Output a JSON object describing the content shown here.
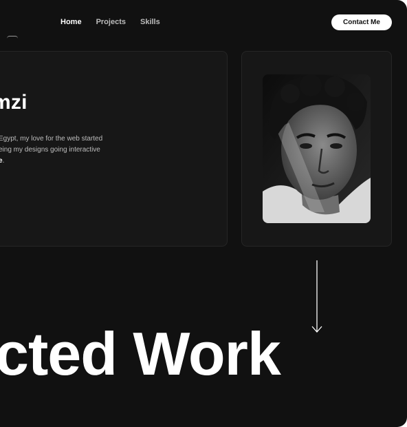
{
  "nav": {
    "items": [
      {
        "label": "Home",
        "active": true
      },
      {
        "label": "Projects",
        "active": false
      },
      {
        "label": "Skills",
        "active": false
      }
    ],
    "contact_label": "Contact Me"
  },
  "intro": {
    "title": "mzi",
    "lines": [
      "Egypt, my love for the web started",
      "eing my designs going interactive"
    ],
    "last_prefix": "",
    "last_emphasis": "e",
    "last_suffix": "."
  },
  "photo": {
    "icon": "profile-photo"
  },
  "scroll": {
    "icon": "arrow-down-icon"
  },
  "section": {
    "title": "cted Work"
  },
  "colors": {
    "background": "#111111",
    "card": "#171717",
    "text": "#ffffff",
    "muted": "#bdbdbd"
  }
}
